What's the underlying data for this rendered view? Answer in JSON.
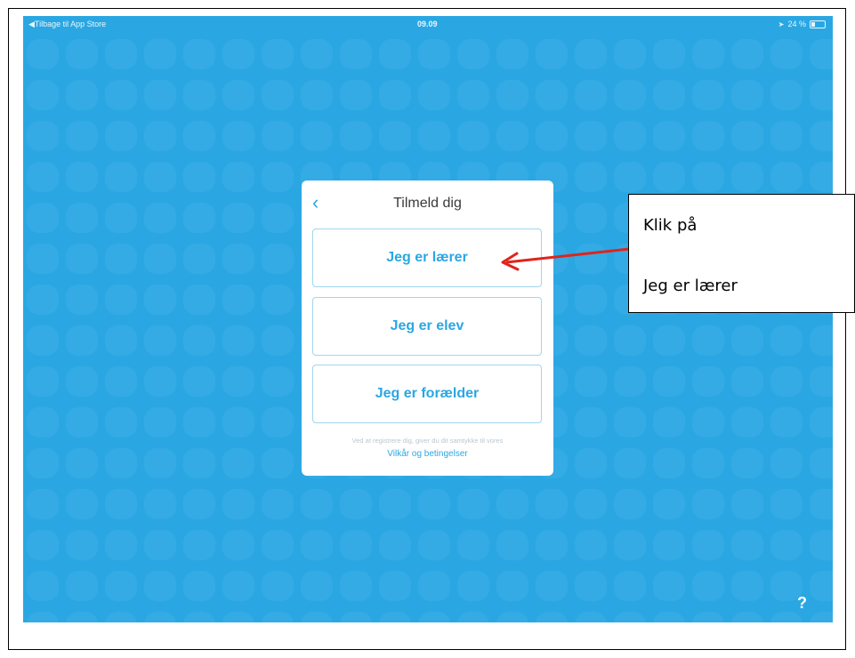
{
  "statusbar": {
    "back_label": "Tilbage til App Store",
    "time": "09.09",
    "battery": "24 %"
  },
  "card": {
    "back_icon": "chevron-left-icon",
    "title": "Tilmeld dig",
    "options": [
      "Jeg er lærer",
      "Jeg er elev",
      "Jeg er forælder"
    ],
    "consent_text": "Ved at registrere dig, giver du dit samtykke til vores",
    "terms_link": "Vilkår og betingelser"
  },
  "help_label": "?",
  "callout": {
    "line1": "Klik på",
    "line2": "Jeg er lærer"
  },
  "colors": {
    "background": "#2aa7e3",
    "accent": "#2aa7e3",
    "arrow": "#e0241b"
  }
}
